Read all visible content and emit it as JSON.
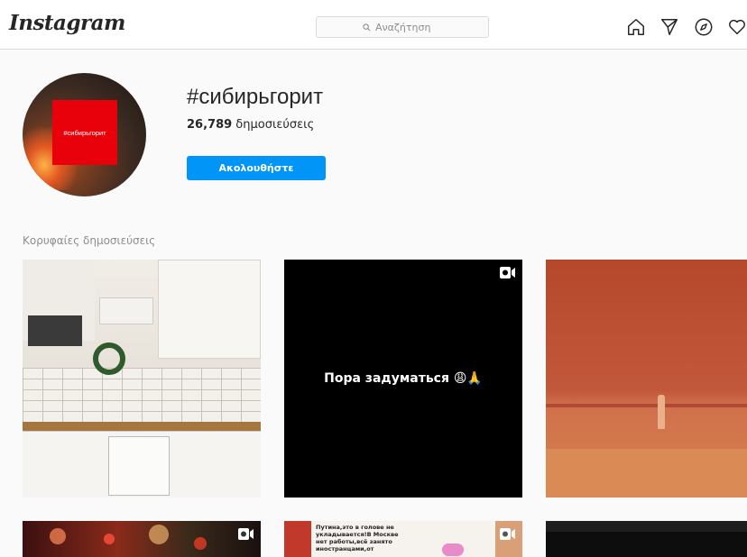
{
  "app": {
    "logo": "Instagram"
  },
  "search": {
    "placeholder": "Αναζήτηση"
  },
  "nav": {
    "icons": [
      "home-icon",
      "direct-icon",
      "explore-icon",
      "activity-icon"
    ]
  },
  "profile": {
    "avatar_text": "#сибирьгорит",
    "title": "#сибирьгорит",
    "post_count": "26,789",
    "post_label": " δημοσιεύσεις",
    "follow_label": "Ακολουθήστε"
  },
  "section": {
    "top_posts_label": "Κορυφαίες δημοσιεύσεις"
  },
  "posts": [
    {
      "type": "image",
      "video": false
    },
    {
      "type": "video",
      "video": true,
      "overlay_text": "Пора задуматься 😩🙏"
    },
    {
      "type": "image",
      "video": false
    },
    {
      "type": "video",
      "video": true
    },
    {
      "type": "image",
      "video": true,
      "overlay_text": "Путина,это в голове не укладывается!В Москве нет работы,всё занято иностранцами,от"
    },
    {
      "type": "image",
      "video": false
    }
  ],
  "colors": {
    "accent": "#0095f6",
    "background": "#fafafa",
    "text": "#262626",
    "muted": "#8e8e8e"
  }
}
